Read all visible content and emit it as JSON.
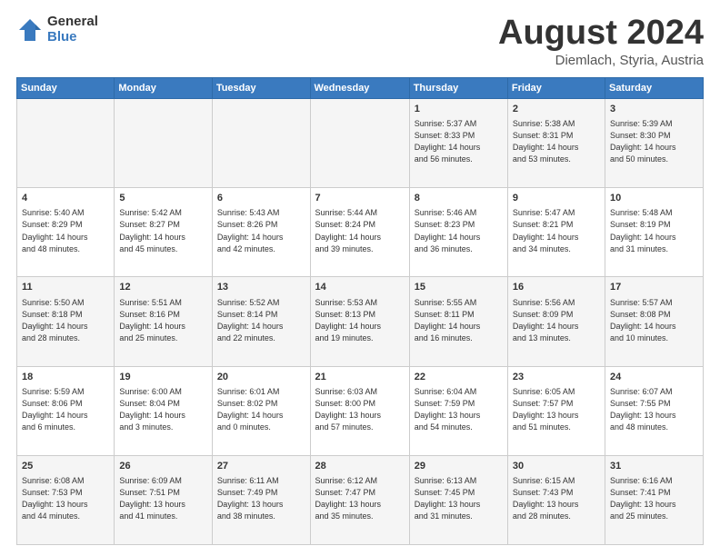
{
  "logo": {
    "general": "General",
    "blue": "Blue"
  },
  "title": {
    "month_year": "August 2024",
    "location": "Diemlach, Styria, Austria"
  },
  "weekdays": [
    "Sunday",
    "Monday",
    "Tuesday",
    "Wednesday",
    "Thursday",
    "Friday",
    "Saturday"
  ],
  "weeks": [
    [
      {
        "day": "",
        "info": ""
      },
      {
        "day": "",
        "info": ""
      },
      {
        "day": "",
        "info": ""
      },
      {
        "day": "",
        "info": ""
      },
      {
        "day": "1",
        "info": "Sunrise: 5:37 AM\nSunset: 8:33 PM\nDaylight: 14 hours\nand 56 minutes."
      },
      {
        "day": "2",
        "info": "Sunrise: 5:38 AM\nSunset: 8:31 PM\nDaylight: 14 hours\nand 53 minutes."
      },
      {
        "day": "3",
        "info": "Sunrise: 5:39 AM\nSunset: 8:30 PM\nDaylight: 14 hours\nand 50 minutes."
      }
    ],
    [
      {
        "day": "4",
        "info": "Sunrise: 5:40 AM\nSunset: 8:29 PM\nDaylight: 14 hours\nand 48 minutes."
      },
      {
        "day": "5",
        "info": "Sunrise: 5:42 AM\nSunset: 8:27 PM\nDaylight: 14 hours\nand 45 minutes."
      },
      {
        "day": "6",
        "info": "Sunrise: 5:43 AM\nSunset: 8:26 PM\nDaylight: 14 hours\nand 42 minutes."
      },
      {
        "day": "7",
        "info": "Sunrise: 5:44 AM\nSunset: 8:24 PM\nDaylight: 14 hours\nand 39 minutes."
      },
      {
        "day": "8",
        "info": "Sunrise: 5:46 AM\nSunset: 8:23 PM\nDaylight: 14 hours\nand 36 minutes."
      },
      {
        "day": "9",
        "info": "Sunrise: 5:47 AM\nSunset: 8:21 PM\nDaylight: 14 hours\nand 34 minutes."
      },
      {
        "day": "10",
        "info": "Sunrise: 5:48 AM\nSunset: 8:19 PM\nDaylight: 14 hours\nand 31 minutes."
      }
    ],
    [
      {
        "day": "11",
        "info": "Sunrise: 5:50 AM\nSunset: 8:18 PM\nDaylight: 14 hours\nand 28 minutes."
      },
      {
        "day": "12",
        "info": "Sunrise: 5:51 AM\nSunset: 8:16 PM\nDaylight: 14 hours\nand 25 minutes."
      },
      {
        "day": "13",
        "info": "Sunrise: 5:52 AM\nSunset: 8:14 PM\nDaylight: 14 hours\nand 22 minutes."
      },
      {
        "day": "14",
        "info": "Sunrise: 5:53 AM\nSunset: 8:13 PM\nDaylight: 14 hours\nand 19 minutes."
      },
      {
        "day": "15",
        "info": "Sunrise: 5:55 AM\nSunset: 8:11 PM\nDaylight: 14 hours\nand 16 minutes."
      },
      {
        "day": "16",
        "info": "Sunrise: 5:56 AM\nSunset: 8:09 PM\nDaylight: 14 hours\nand 13 minutes."
      },
      {
        "day": "17",
        "info": "Sunrise: 5:57 AM\nSunset: 8:08 PM\nDaylight: 14 hours\nand 10 minutes."
      }
    ],
    [
      {
        "day": "18",
        "info": "Sunrise: 5:59 AM\nSunset: 8:06 PM\nDaylight: 14 hours\nand 6 minutes."
      },
      {
        "day": "19",
        "info": "Sunrise: 6:00 AM\nSunset: 8:04 PM\nDaylight: 14 hours\nand 3 minutes."
      },
      {
        "day": "20",
        "info": "Sunrise: 6:01 AM\nSunset: 8:02 PM\nDaylight: 14 hours\nand 0 minutes."
      },
      {
        "day": "21",
        "info": "Sunrise: 6:03 AM\nSunset: 8:00 PM\nDaylight: 13 hours\nand 57 minutes."
      },
      {
        "day": "22",
        "info": "Sunrise: 6:04 AM\nSunset: 7:59 PM\nDaylight: 13 hours\nand 54 minutes."
      },
      {
        "day": "23",
        "info": "Sunrise: 6:05 AM\nSunset: 7:57 PM\nDaylight: 13 hours\nand 51 minutes."
      },
      {
        "day": "24",
        "info": "Sunrise: 6:07 AM\nSunset: 7:55 PM\nDaylight: 13 hours\nand 48 minutes."
      }
    ],
    [
      {
        "day": "25",
        "info": "Sunrise: 6:08 AM\nSunset: 7:53 PM\nDaylight: 13 hours\nand 44 minutes."
      },
      {
        "day": "26",
        "info": "Sunrise: 6:09 AM\nSunset: 7:51 PM\nDaylight: 13 hours\nand 41 minutes."
      },
      {
        "day": "27",
        "info": "Sunrise: 6:11 AM\nSunset: 7:49 PM\nDaylight: 13 hours\nand 38 minutes."
      },
      {
        "day": "28",
        "info": "Sunrise: 6:12 AM\nSunset: 7:47 PM\nDaylight: 13 hours\nand 35 minutes."
      },
      {
        "day": "29",
        "info": "Sunrise: 6:13 AM\nSunset: 7:45 PM\nDaylight: 13 hours\nand 31 minutes."
      },
      {
        "day": "30",
        "info": "Sunrise: 6:15 AM\nSunset: 7:43 PM\nDaylight: 13 hours\nand 28 minutes."
      },
      {
        "day": "31",
        "info": "Sunrise: 6:16 AM\nSunset: 7:41 PM\nDaylight: 13 hours\nand 25 minutes."
      }
    ]
  ]
}
